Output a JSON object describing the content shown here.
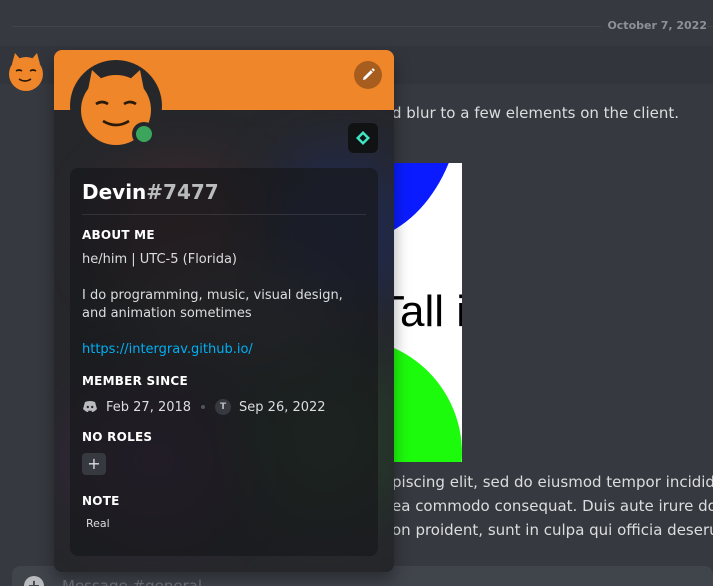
{
  "chat": {
    "date": "October 7, 2022",
    "line1": "d blur to a few elements on the client.",
    "image_text": "Tall image",
    "lorem1": "piscing elit, sed do eiusmod tempor incididunt",
    "lorem2": "ea commodo consequat. Duis aute irure dolor",
    "lorem3": "on proident, sunt in culpa qui officia deserunt",
    "composer_placeholder": "Message #general",
    "composer_plus": "+"
  },
  "profile": {
    "username": "Devin",
    "discriminator": "#7477",
    "about_heading": "About Me",
    "about_line1": "he/him | UTC-5 (Florida)",
    "about_line2": "I do programming, music, visual design, and animation sometimes",
    "about_link": "https://intergrav.github.io/",
    "member_since_heading": "Member Since",
    "discord_date": "Feb 27, 2018",
    "server_initial": "T",
    "server_date": "Sep 26, 2022",
    "roles_heading": "No Roles",
    "add_role": "+",
    "note_heading": "Note",
    "note_text": "Real",
    "status": "online"
  },
  "colors": {
    "banner": "#f0862a",
    "status_online": "#3ba55d",
    "link": "#00aff4",
    "background": "#36393f"
  },
  "icons": {
    "edit": "pencil-icon",
    "badge": "diamond-badge-icon",
    "member_since": "discord-icon"
  }
}
